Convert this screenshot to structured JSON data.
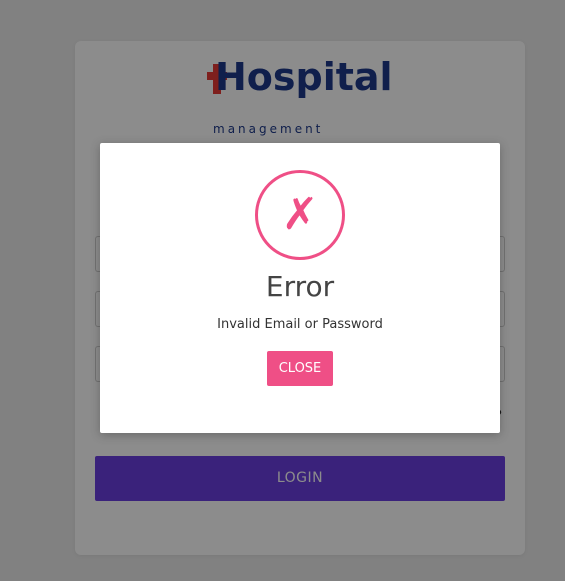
{
  "logo": {
    "text": "Hospital",
    "subtitle": "management",
    "icon": "medical-cross-icon"
  },
  "login_form": {
    "login_button_label": "LOGIN",
    "forgot_suffix": "?"
  },
  "modal": {
    "icon": "error-x-icon",
    "icon_glyph": "✗",
    "title": "Error",
    "message": "Invalid Email or Password",
    "close_label": "CLOSE"
  },
  "colors": {
    "accent_pink": "#ef4f86",
    "login_button": "#6a3fe0",
    "logo_blue": "#1e3a8a",
    "logo_red": "#e53935"
  }
}
